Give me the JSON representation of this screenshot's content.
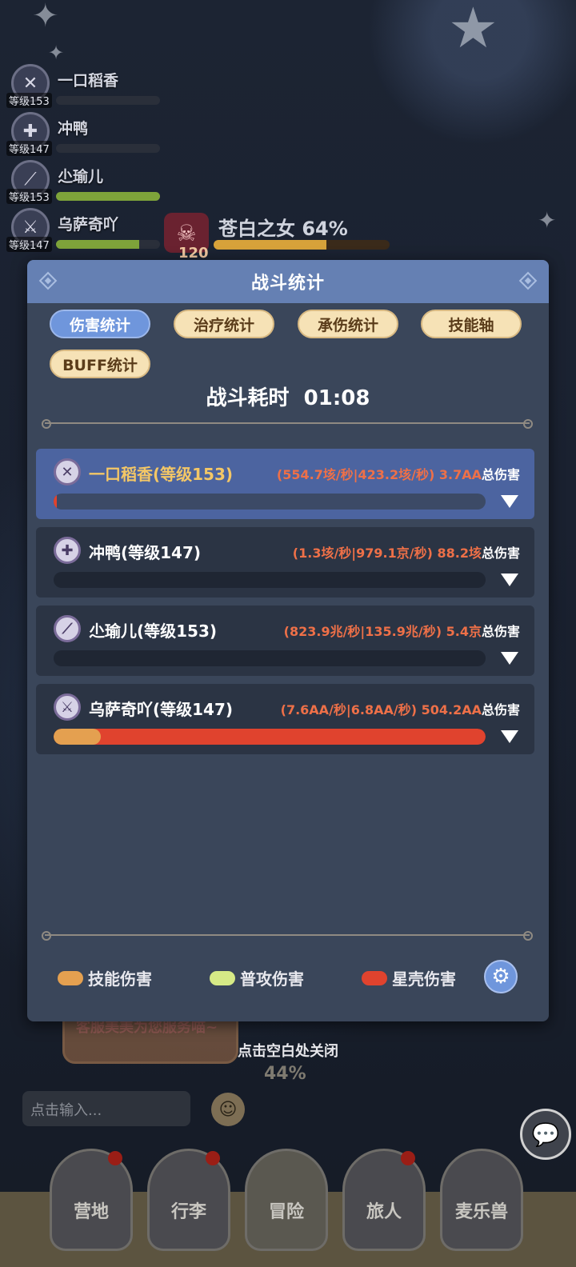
{
  "party": [
    {
      "name": "一口稻香",
      "level": "等级153",
      "hp": 0.0
    },
    {
      "name": "冲鸭",
      "level": "等级147",
      "hp": 0.0
    },
    {
      "name": "尐瑜儿",
      "level": "等级153",
      "hp": 1.0
    },
    {
      "name": "乌萨奇吖",
      "level": "等级147",
      "hp": 0.8
    }
  ],
  "boss": {
    "name": "苍白之女",
    "hp_percent": "64%",
    "level": "120"
  },
  "dialog": {
    "title": "战斗统计",
    "tabs": [
      {
        "label": "伤害统计",
        "active": true
      },
      {
        "label": "治疗统计",
        "active": false
      },
      {
        "label": "承伤统计",
        "active": false
      },
      {
        "label": "技能轴",
        "active": false
      },
      {
        "label": "BUFF统计",
        "active": false
      }
    ],
    "duration_label": "战斗耗时",
    "duration_value": "01:08",
    "rows": [
      {
        "name": "一口稻香(等级153)",
        "rates": "(554.7垓/秒|423.2垓/秒)",
        "total": "3.7AA",
        "total_label": "总伤害",
        "selected": true,
        "skill_fill": 0.0,
        "star_fill": 0.007
      },
      {
        "name": "冲鸭(等级147)",
        "rates": "(1.3垓/秒|979.1京/秒)",
        "total": "88.2垓",
        "total_label": "总伤害",
        "selected": false,
        "skill_fill": 0,
        "star_fill": 0
      },
      {
        "name": "尐瑜儿(等级153)",
        "rates": "(823.9兆/秒|135.9兆/秒)",
        "total": "5.4京",
        "total_label": "总伤害",
        "selected": false,
        "skill_fill": 0,
        "star_fill": 0
      },
      {
        "name": "乌萨奇吖(等级147)",
        "rates": "(7.6AA/秒|6.8AA/秒)",
        "total": "504.2AA",
        "total_label": "总伤害",
        "selected": false,
        "skill_fill": 0.11,
        "star_fill": 1.0
      }
    ],
    "legend": [
      {
        "label": "技能伤害",
        "color": "#e4a050"
      },
      {
        "label": "普攻伤害",
        "color": "#d6ea86"
      },
      {
        "label": "星壳伤害",
        "color": "#e0432e"
      }
    ]
  },
  "close_hint": "点击空白处关闭",
  "service_text": "客服美美为您服务喵~",
  "skill_percent": "44%",
  "chat_placeholder": "点击输入...",
  "nav": [
    {
      "label": "营地",
      "badge": true
    },
    {
      "label": "行李",
      "badge": true
    },
    {
      "label": "冒险",
      "badge": false
    },
    {
      "label": "旅人",
      "badge": true
    },
    {
      "label": "麦乐兽",
      "badge": false
    }
  ]
}
